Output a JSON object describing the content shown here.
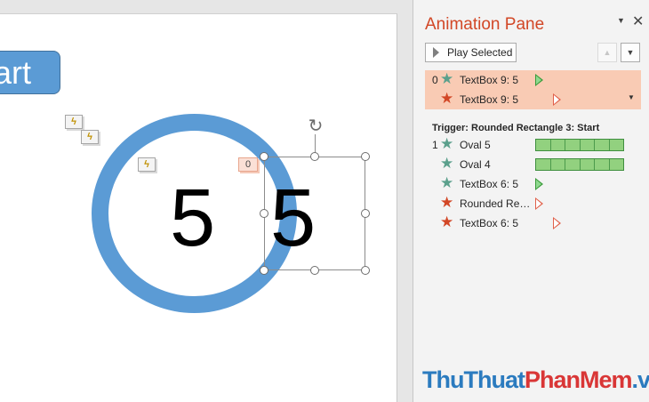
{
  "slide": {
    "start_label": "art",
    "anim_tag_number": "0",
    "digit_left": "5",
    "digit_right": "5",
    "trigger_icon": "lightning-icon",
    "rotate_icon": "rotate-icon"
  },
  "pane": {
    "title": "Animation Pane",
    "menu_icon": "▼",
    "close_icon": "✕",
    "play_button_label": "Play Selected",
    "move_up_icon": "▲",
    "move_down_icon": "▼",
    "selected_rows": [
      {
        "number": "0",
        "star": "green",
        "label": "TextBox 9: 5",
        "timing": "triangle-green"
      },
      {
        "number": "",
        "star": "red",
        "label": "TextBox 9: 5",
        "timing": "triangle-red"
      }
    ],
    "trigger_header": "Trigger: Rounded Rectangle 3: Start",
    "trigger_rows": [
      {
        "number": "1",
        "star": "green",
        "label": "Oval 5",
        "timing": "bar"
      },
      {
        "number": "",
        "star": "green",
        "label": "Oval 4",
        "timing": "bar"
      },
      {
        "number": "",
        "star": "green",
        "label": "TextBox 6: 5",
        "timing": "triangle-green"
      },
      {
        "number": "",
        "star": "red",
        "label": "Rounded Rect...",
        "timing": "triangle-red"
      },
      {
        "number": "",
        "star": "red",
        "label": "TextBox 6: 5",
        "timing": "triangle-red"
      }
    ],
    "row_dropdown_icon": "▼"
  },
  "watermark": {
    "part1": "ThuThuat",
    "part2": "PhanMem",
    "part3": ".vn"
  },
  "colors": {
    "accent": "#d24726",
    "shape_blue": "#5b9bd5",
    "selected_row": "#f9cbb4",
    "bar_green": "#92d17f"
  }
}
